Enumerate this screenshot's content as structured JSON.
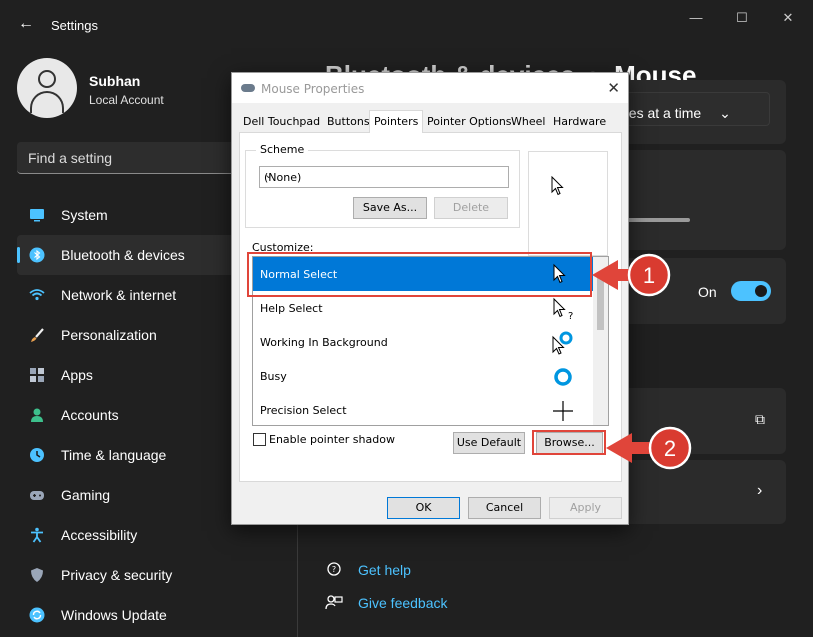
{
  "window": {
    "title": "Settings",
    "controls": {
      "minimize": "—",
      "maximize": "☐",
      "close": "✕"
    }
  },
  "user": {
    "name": "Subhan",
    "account": "Local Account"
  },
  "search": {
    "placeholder": "Find a setting"
  },
  "sidebar": {
    "items": [
      {
        "label": "System",
        "icon": "system-icon",
        "color": "#4cc2ff"
      },
      {
        "label": "Bluetooth & devices",
        "icon": "bluetooth-icon",
        "color": "#4cc2ff",
        "active": true
      },
      {
        "label": "Network & internet",
        "icon": "wifi-icon",
        "color": "#4cc2ff"
      },
      {
        "label": "Personalization",
        "icon": "brush-icon",
        "color": "#e8a050"
      },
      {
        "label": "Apps",
        "icon": "apps-icon",
        "color": "#9aa6b8"
      },
      {
        "label": "Accounts",
        "icon": "accounts-icon",
        "color": "#3dc08c"
      },
      {
        "label": "Time & language",
        "icon": "clock-globe-icon",
        "color": "#4cc2ff"
      },
      {
        "label": "Gaming",
        "icon": "gamepad-icon",
        "color": "#9aa6b8"
      },
      {
        "label": "Accessibility",
        "icon": "accessibility-icon",
        "color": "#4cc2ff"
      },
      {
        "label": "Privacy & security",
        "icon": "shield-icon",
        "color": "#9aa6b8"
      },
      {
        "label": "Windows Update",
        "icon": "update-icon",
        "color": "#4cc2ff"
      }
    ]
  },
  "main": {
    "breadcrumb_partial": "Bluetooth & devices",
    "breadcrumb_sep": "›",
    "page_title": "Mouse",
    "scroll_setting_partial": "le lines at a time",
    "toggle_state": "On",
    "links": [
      {
        "label": "Get help",
        "icon": "help-icon"
      },
      {
        "label": "Give feedback",
        "icon": "feedback-icon"
      }
    ]
  },
  "dialog": {
    "title": "Mouse Properties",
    "close": "✕",
    "tabs": [
      {
        "label": "Dell Touchpad"
      },
      {
        "label": "Buttons"
      },
      {
        "label": "Pointers",
        "active": true
      },
      {
        "label": "Pointer Options"
      },
      {
        "label": "Wheel"
      },
      {
        "label": "Hardware"
      }
    ],
    "scheme": {
      "label": "Scheme",
      "value": "(None)",
      "save_as": "Save As...",
      "delete": "Delete"
    },
    "customize_label": "Customize:",
    "cursors": [
      {
        "label": "Normal Select",
        "icon": "arrow-cursor-icon",
        "selected": true
      },
      {
        "label": "Help Select",
        "icon": "help-cursor-icon"
      },
      {
        "label": "Working In Background",
        "icon": "working-cursor-icon"
      },
      {
        "label": "Busy",
        "icon": "busy-cursor-icon"
      },
      {
        "label": "Precision Select",
        "icon": "crosshair-cursor-icon"
      }
    ],
    "shadow_label": "Enable pointer shadow",
    "use_default": "Use Default",
    "browse": "Browse...",
    "ok": "OK",
    "cancel": "Cancel",
    "apply": "Apply"
  },
  "annotations": [
    {
      "number": "1",
      "color": "#e0453a"
    },
    {
      "number": "2",
      "color": "#e0453a"
    }
  ]
}
